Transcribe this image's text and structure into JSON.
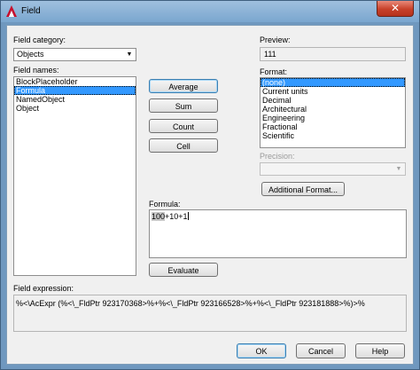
{
  "window": {
    "title": "Field",
    "close_glyph": "✕"
  },
  "field_category": {
    "label": "Field category:",
    "selected": "Objects"
  },
  "field_names": {
    "label": "Field names:",
    "items": [
      {
        "label": "BlockPlaceholder",
        "selected": false
      },
      {
        "label": "Formula",
        "selected": true
      },
      {
        "label": "NamedObject",
        "selected": false
      },
      {
        "label": "Object",
        "selected": false
      }
    ]
  },
  "buttons": {
    "average": "Average",
    "sum": "Sum",
    "count": "Count",
    "cell": "Cell",
    "evaluate": "Evaluate",
    "additional_format": "Additional Format...",
    "ok": "OK",
    "cancel": "Cancel",
    "help": "Help"
  },
  "preview": {
    "label": "Preview:",
    "value": "111"
  },
  "format": {
    "label": "Format:",
    "items": [
      {
        "label": "(none)",
        "selected": true
      },
      {
        "label": "Current units",
        "selected": false
      },
      {
        "label": "Decimal",
        "selected": false
      },
      {
        "label": "Architectural",
        "selected": false
      },
      {
        "label": "Engineering",
        "selected": false
      },
      {
        "label": "Fractional",
        "selected": false
      },
      {
        "label": "Scientific",
        "selected": false
      }
    ]
  },
  "precision": {
    "label": "Precision:",
    "value": ""
  },
  "formula": {
    "label": "Formula:",
    "highlighted": "100",
    "rest": "+10+1"
  },
  "field_expression": {
    "label": "Field expression:",
    "value": "%<\\AcExpr (%<\\_FldPtr 923170368>%+%<\\_FldPtr 923166528>%+%<\\_FldPtr 923181888>%)>%"
  },
  "icons": {
    "app": "autocad-logo-icon",
    "dropdown": "chevron-down-icon",
    "close": "close-icon"
  },
  "colors": {
    "selection": "#3399ff",
    "close_button": "#c7412a",
    "window_frame": "#6f98bf"
  }
}
